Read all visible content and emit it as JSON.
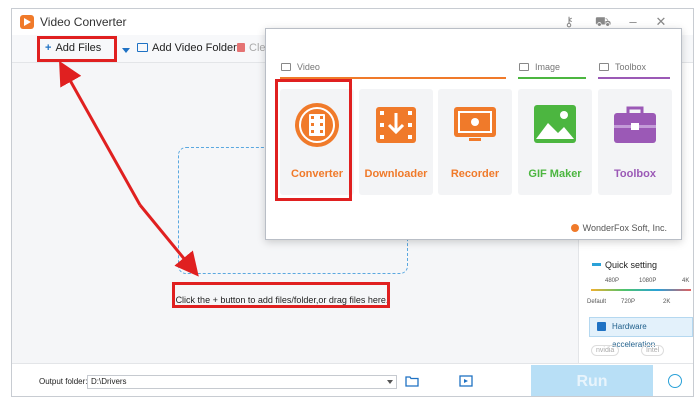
{
  "app": {
    "title": "Video Converter"
  },
  "toolbar": {
    "add_files": "Add Files",
    "add_video_folder": "Add Video Folder",
    "clear": "Clea"
  },
  "dropzone": {
    "hint": "Click the + button to add files/folder,or drag files here."
  },
  "right_panel": {
    "quick_setting": "Quick setting",
    "resolutions_top": [
      "480P",
      "1080P",
      "4K"
    ],
    "resolutions_bottom": [
      "Default",
      "720P",
      "2K"
    ],
    "hardware_acceleration": "Hardware acceleration",
    "vendors": [
      "nvidia",
      "Intel"
    ]
  },
  "bottom_bar": {
    "output_folder_label": "Output folder:",
    "output_folder_value": "D:\\Drivers",
    "run_label": "Run"
  },
  "popup": {
    "categories": {
      "video": "Video",
      "image": "Image",
      "toolbox": "Toolbox"
    },
    "tiles": [
      {
        "label": "Converter",
        "color": "#f07a2a"
      },
      {
        "label": "Downloader",
        "color": "#f07a2a"
      },
      {
        "label": "Recorder",
        "color": "#f07a2a"
      },
      {
        "label": "GIF Maker",
        "color": "#4cb640"
      },
      {
        "label": "Toolbox",
        "color": "#9b59b6"
      }
    ],
    "brand": "WonderFox Soft, Inc."
  },
  "colors": {
    "accent": "#1f72c4",
    "orange": "#f07a2a",
    "green": "#4cb640",
    "purple": "#9b59b6",
    "annotation": "#e02020"
  }
}
